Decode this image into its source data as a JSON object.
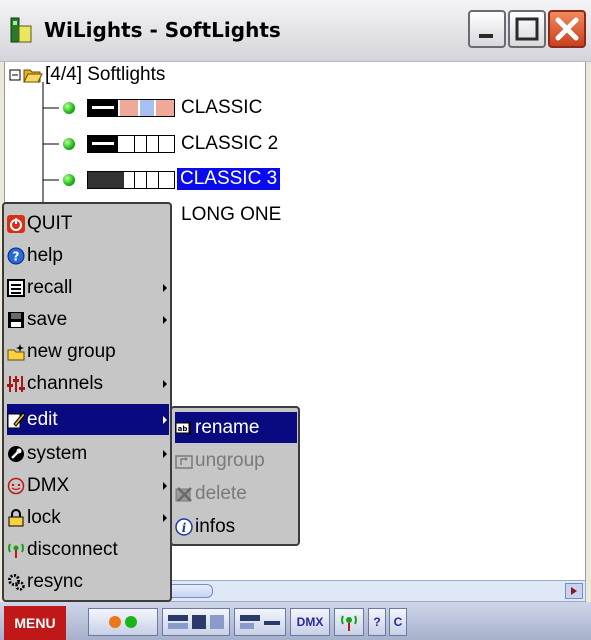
{
  "window": {
    "title": "WiLights - SoftLights",
    "buttons": [
      "minimize",
      "maximize",
      "close"
    ]
  },
  "tree": {
    "root_label": "[4/4] Softlights",
    "items": [
      {
        "label": "CLASSIC",
        "selected": false,
        "active": true
      },
      {
        "label": "CLASSIC 2",
        "selected": false,
        "active": true
      },
      {
        "label": "CLASSIC 3",
        "selected": true,
        "active": true
      },
      {
        "label": "LONG ONE",
        "selected": false,
        "active": false
      }
    ]
  },
  "main_menu": {
    "items": [
      {
        "label": "QUIT",
        "icon": "power-icon"
      },
      {
        "label": "help",
        "icon": "help-icon"
      },
      {
        "label": "recall",
        "icon": "list-icon",
        "submenu": true
      },
      {
        "label": "save",
        "icon": "floppy-icon",
        "submenu": true
      },
      {
        "label": "new group",
        "icon": "new-folder-icon"
      },
      {
        "label": "channels",
        "icon": "sliders-icon",
        "submenu": true
      },
      {
        "label": "edit",
        "icon": "edit-icon",
        "submenu": true,
        "highlighted": true
      },
      {
        "label": "system",
        "icon": "wrench-icon",
        "submenu": true
      },
      {
        "label": "DMX",
        "icon": "dmx-icon",
        "submenu": true
      },
      {
        "label": "lock",
        "icon": "lock-icon",
        "submenu": true
      },
      {
        "label": "disconnect",
        "icon": "antenna-icon"
      },
      {
        "label": "resync",
        "icon": "gear-icon"
      }
    ]
  },
  "edit_submenu": {
    "items": [
      {
        "label": "rename",
        "icon": "rename-icon",
        "highlighted": true,
        "enabled": true
      },
      {
        "label": "ungroup",
        "icon": "ungroup-icon",
        "enabled": false
      },
      {
        "label": "delete",
        "icon": "delete-icon",
        "enabled": false
      },
      {
        "label": "infos",
        "icon": "info-icon",
        "enabled": true
      }
    ]
  },
  "bottom_bar": {
    "menu_label": "MENU",
    "dmx_label": "DMX",
    "c_label": "C",
    "help_label": "?"
  },
  "colors": {
    "selection": "#0a0aee",
    "menu_highlight": "#0a0a80",
    "menu_bg": "#c6c6c6",
    "menu_button": "#c01818",
    "led": "#18b418"
  }
}
